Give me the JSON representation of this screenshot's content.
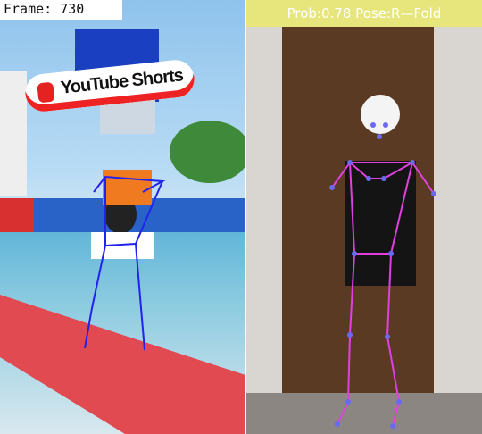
{
  "left_panel": {
    "frame_label": "Frame: 730",
    "logo_text": "YouTube Shorts",
    "skeleton_color": "#2222ee"
  },
  "right_panel": {
    "status_text": "Prob:0.78  Pose:R—Fold",
    "status_bg": "#e6e67c",
    "skeleton_color": "#e040e0",
    "keypoint_color": "#6a6af0"
  }
}
